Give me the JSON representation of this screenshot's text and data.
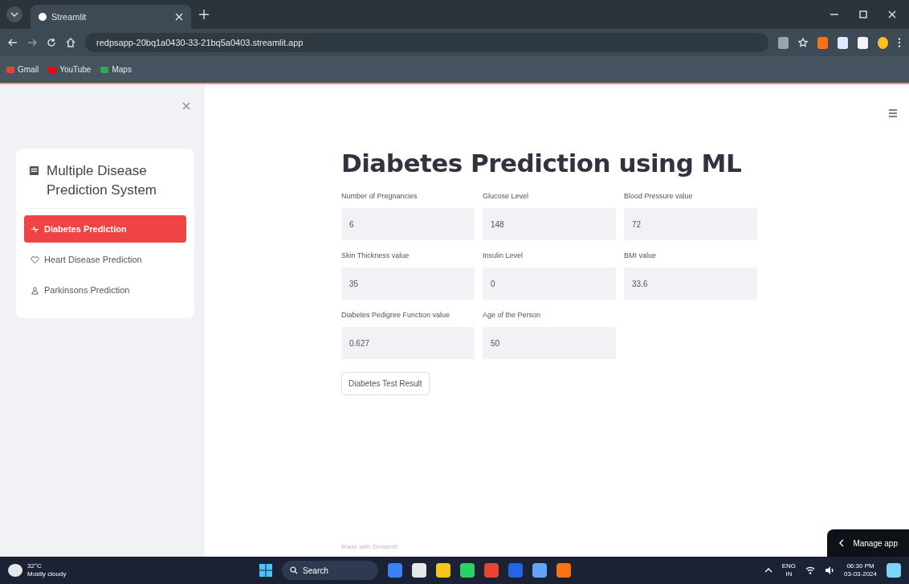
{
  "browser": {
    "tab_title": "Streamlit",
    "url": "redpsapp-20bq1a0430-33-21bq5a0403.streamlit.app",
    "bookmarks": [
      {
        "label": "Gmail",
        "color": "#ea4335"
      },
      {
        "label": "YouTube",
        "color": "#ff0000"
      },
      {
        "label": "Maps",
        "color": "#34a853"
      }
    ]
  },
  "sidebar": {
    "title": "Multiple Disease Prediction System",
    "items": [
      {
        "label": "Diabetes Prediction",
        "selected": true
      },
      {
        "label": "Heart Disease Prediction",
        "selected": false
      },
      {
        "label": "Parkinsons Prediction",
        "selected": false
      }
    ]
  },
  "main": {
    "title": "Diabetes Prediction using ML",
    "fields": [
      {
        "label": "Number of Pregnancies",
        "value": "6"
      },
      {
        "label": "Glucose Level",
        "value": "148"
      },
      {
        "label": "Blood Pressure value",
        "value": "72"
      },
      {
        "label": "Skin Thickness value",
        "value": "35"
      },
      {
        "label": "Insulin Level",
        "value": "0"
      },
      {
        "label": "BMI value",
        "value": "33.6"
      },
      {
        "label": "Diabetes Pedigree Function value",
        "value": "0.627"
      },
      {
        "label": "Age of the Person",
        "value": "50"
      }
    ],
    "button": "Diabetes Test Result",
    "footer": "Made with Streamlit",
    "manage_app": "Manage app"
  },
  "taskbar": {
    "weather_temp": "32°C",
    "weather_text": "Mostly cloudy",
    "search": "Search",
    "lang": "ENG",
    "region": "IN",
    "time": "06:30 PM",
    "date": "03-03-2024"
  }
}
